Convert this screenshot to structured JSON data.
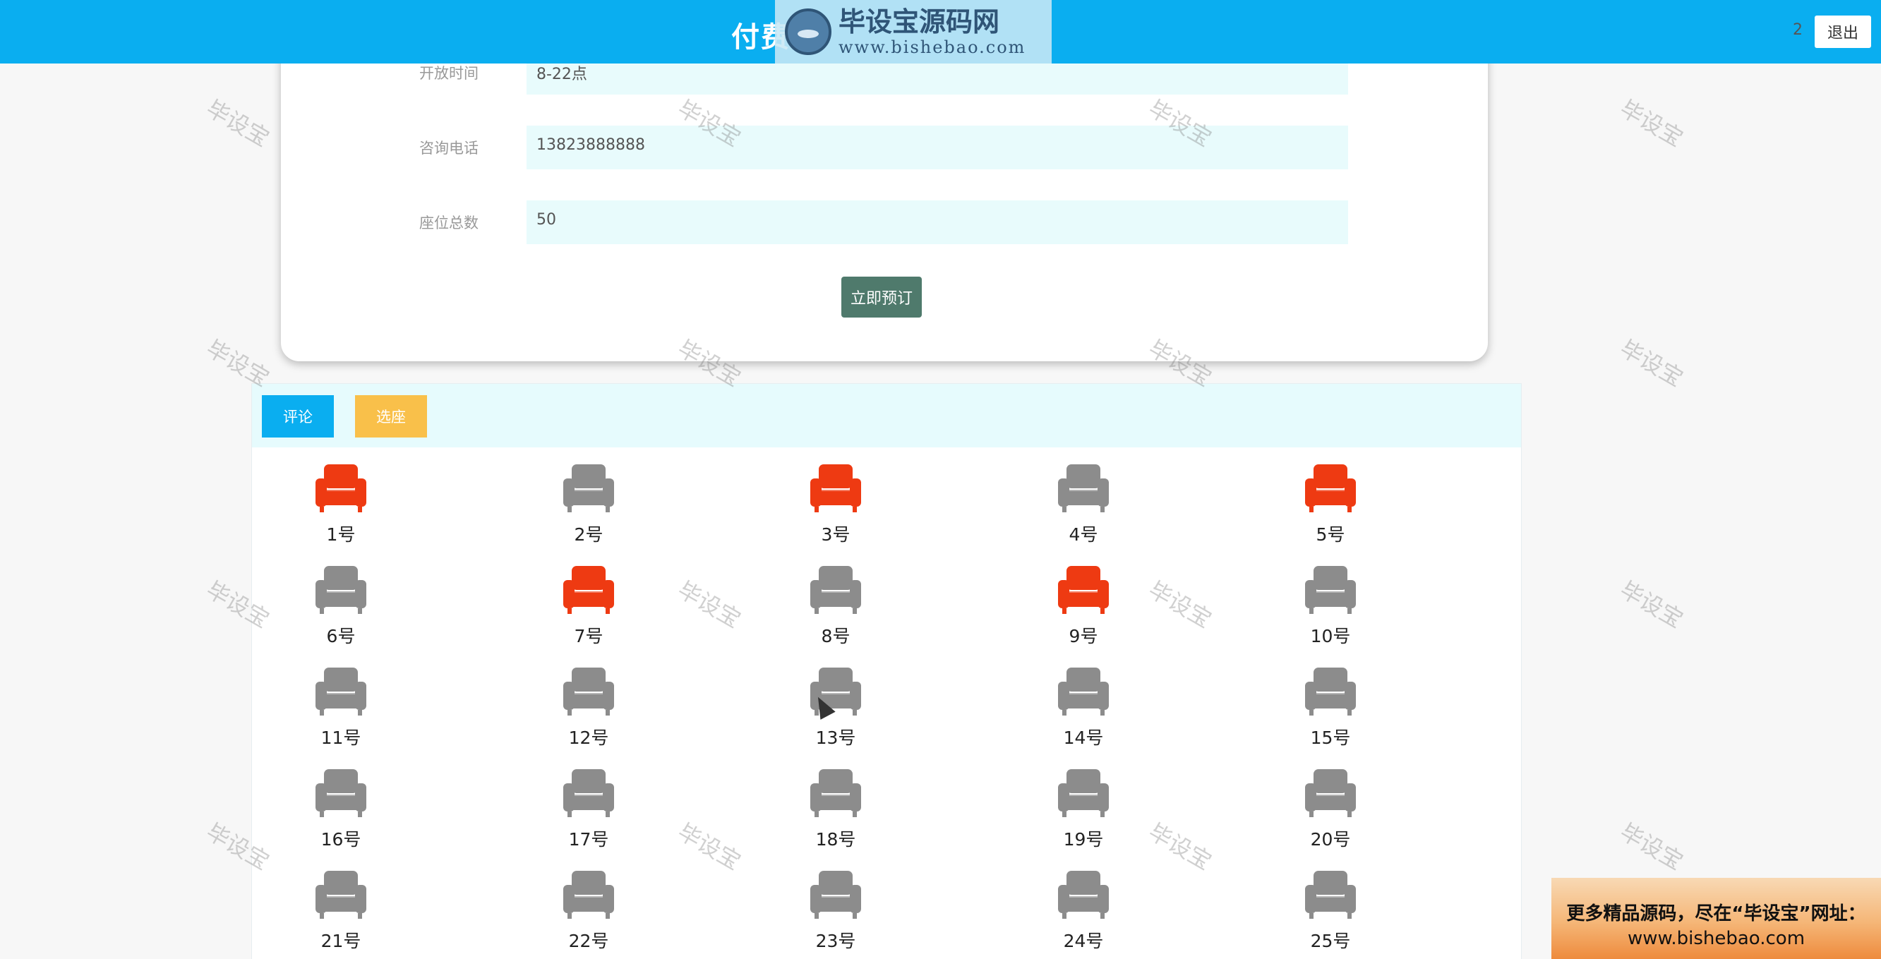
{
  "header": {
    "title": "付费",
    "logo_name": "毕设宝源码网",
    "logo_url": "www.bishebao.com",
    "user": "2",
    "logout_label": "退出"
  },
  "info": {
    "rows": [
      {
        "label": "开放时间",
        "value": "8-22点"
      },
      {
        "label": "咨询电话",
        "value": "13823888888"
      },
      {
        "label": "座位总数",
        "value": "50"
      }
    ],
    "reserve_label": "立即预订"
  },
  "tabs": {
    "comment_label": "评论",
    "select_label": "选座"
  },
  "seats": [
    {
      "label": "1号",
      "status": "occupied"
    },
    {
      "label": "2号",
      "status": "available"
    },
    {
      "label": "3号",
      "status": "occupied"
    },
    {
      "label": "4号",
      "status": "available"
    },
    {
      "label": "5号",
      "status": "occupied"
    },
    {
      "label": "6号",
      "status": "available"
    },
    {
      "label": "7号",
      "status": "occupied"
    },
    {
      "label": "8号",
      "status": "available"
    },
    {
      "label": "9号",
      "status": "occupied"
    },
    {
      "label": "10号",
      "status": "available"
    },
    {
      "label": "11号",
      "status": "available"
    },
    {
      "label": "12号",
      "status": "available"
    },
    {
      "label": "13号",
      "status": "available"
    },
    {
      "label": "14号",
      "status": "available"
    },
    {
      "label": "15号",
      "status": "available"
    },
    {
      "label": "16号",
      "status": "available"
    },
    {
      "label": "17号",
      "status": "available"
    },
    {
      "label": "18号",
      "status": "available"
    },
    {
      "label": "19号",
      "status": "available"
    },
    {
      "label": "20号",
      "status": "available"
    },
    {
      "label": "21号",
      "status": "available"
    },
    {
      "label": "22号",
      "status": "available"
    },
    {
      "label": "23号",
      "status": "available"
    },
    {
      "label": "24号",
      "status": "available"
    },
    {
      "label": "25号",
      "status": "available"
    }
  ],
  "seat_colors": {
    "occupied": "#ee3a12",
    "available": "#8c8c8c"
  },
  "seat_icon": "armchair-icon",
  "watermark_text": "毕设宝",
  "ad": {
    "line1": "更多精品源码，尽在“毕设宝”网址：",
    "line2": "www.bishebao.com"
  }
}
